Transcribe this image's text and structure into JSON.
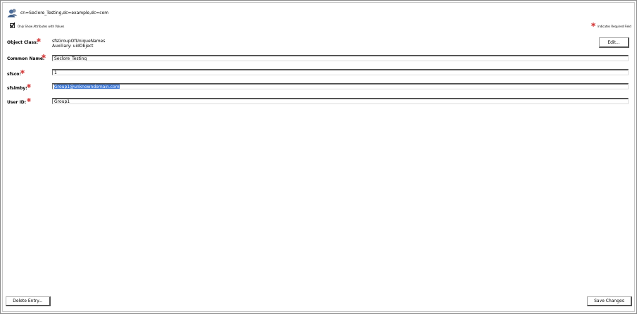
{
  "entry": {
    "dn": "cn=Seclore_Testing,dc=example,dc=com"
  },
  "options": {
    "show_only_with_values": "Only Show Attributes with Values",
    "checked": true
  },
  "legend": {
    "required": "Indicates Required Field"
  },
  "attributes": {
    "object_class": {
      "label": "Object Class:",
      "value_line1": "sfsGroupOfUniqueNames",
      "value_line2": "Auxiliary: uidObject"
    },
    "common_name": {
      "label": "Common Name:",
      "value": "Seclore_Testing"
    },
    "sfsco": {
      "label": "sfsco:",
      "value": "1"
    },
    "sfslmby": {
      "label": "sfslmby:",
      "value": "Group1@unknowndomain.com"
    },
    "user_id": {
      "label": "User ID:",
      "value": "Group1"
    }
  },
  "buttons": {
    "edit": "Edit...",
    "delete": "Delete Entry...",
    "save": "Save Changes"
  },
  "colors": {
    "required_marker": "#d43a3a",
    "selection": "#3875d7"
  },
  "icons": {
    "entry": "group-users-icon",
    "required": "required-asterisk-icon",
    "checkbox": "checkmark-icon"
  }
}
